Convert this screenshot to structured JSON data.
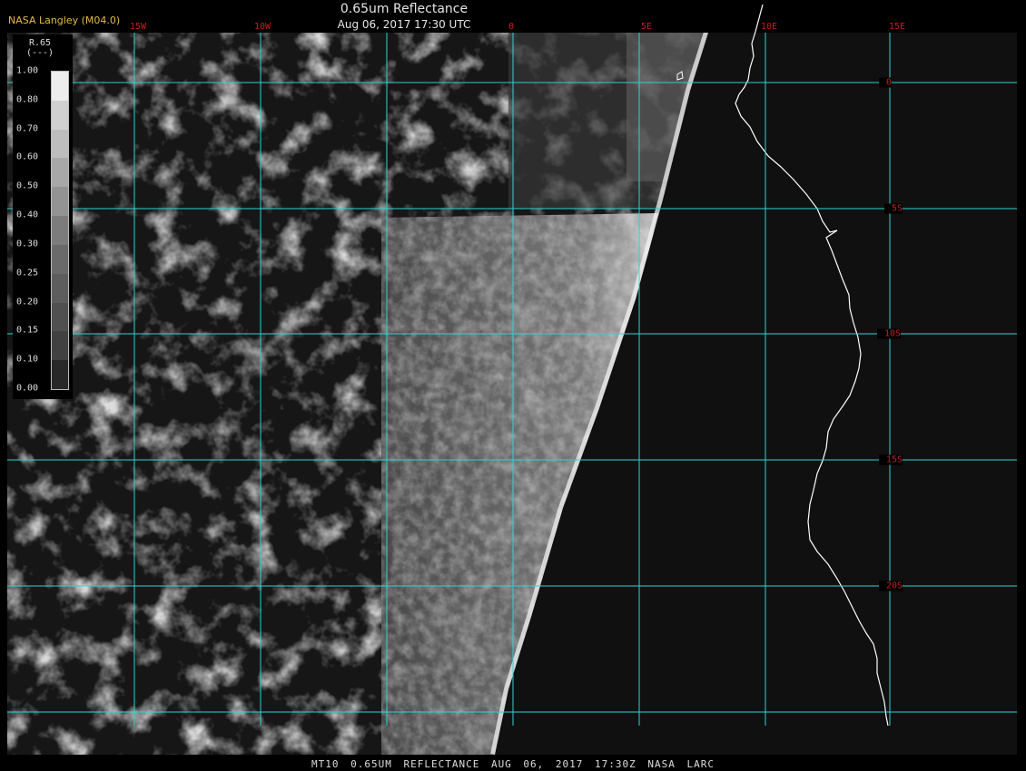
{
  "header": {
    "credit": "NASA Langley (M04.0)",
    "title": "0.65um Reflectance",
    "subtitle": "Aug 06, 2017 17:30 UTC"
  },
  "footer": "MT10  0.65UM REFLECTANCE  AUG 06, 2017 17:30Z  NASA LARC",
  "colorbar": {
    "title_line1": "R.65",
    "title_line2": "(---)",
    "labels": [
      "1.00",
      "0.80",
      "0.70",
      "0.60",
      "0.50",
      "0.40",
      "0.30",
      "0.25",
      "0.20",
      "0.15",
      "0.10",
      "0.00"
    ],
    "values": [
      1.0,
      0.8,
      0.7,
      0.6,
      0.5,
      0.4,
      0.3,
      0.25,
      0.2,
      0.15,
      0.1,
      0.0
    ]
  },
  "longitude_labels": [
    "15W",
    "10W",
    "0",
    "5E",
    "10E",
    "15E"
  ],
  "latitude_labels": [
    "0",
    "5S",
    "10S",
    "15S",
    "20S"
  ],
  "colors": {
    "grid": "#2fd3d3",
    "coastline": "#ffffff",
    "grid_label": "#c81e1e",
    "credit": "#e8b84a",
    "background": "#101010"
  }
}
